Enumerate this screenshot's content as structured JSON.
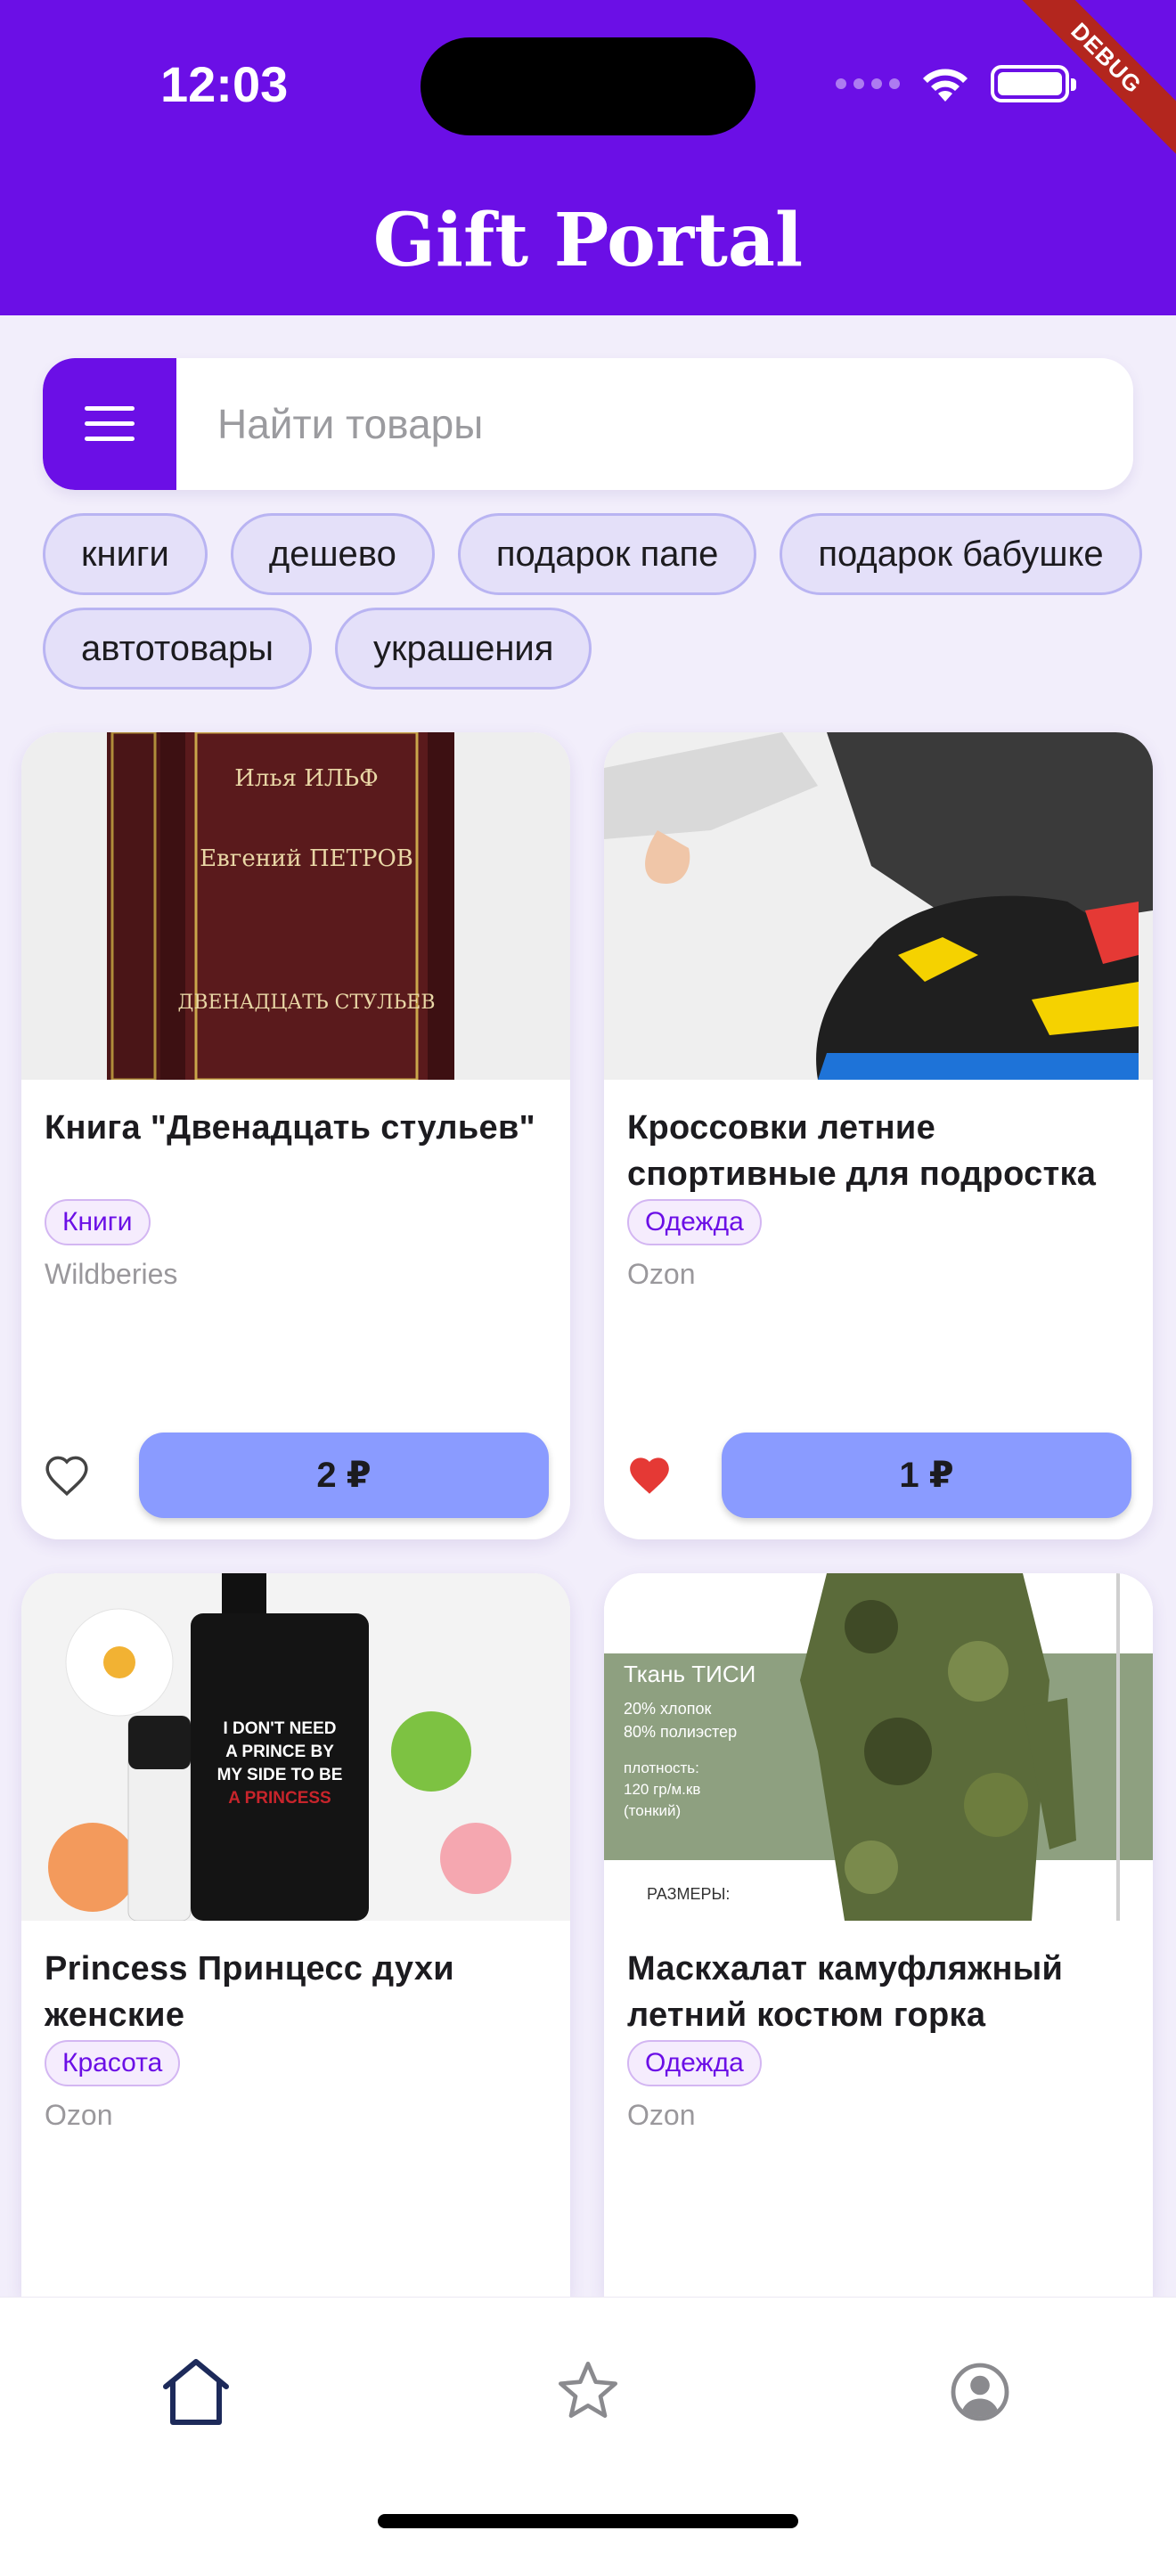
{
  "status_bar": {
    "time": "12:03",
    "debug_label": "DEBUG"
  },
  "app": {
    "title": "Gift Portal"
  },
  "search": {
    "placeholder": "Найти товары",
    "menu_icon": "menu-icon"
  },
  "chips": {
    "row1": [
      "книги",
      "дешево",
      "подарок папе",
      "подарок бабушке"
    ],
    "row2": [
      "автотовары",
      "украшения"
    ]
  },
  "products": [
    {
      "title": "Книга \"Двенадцать стульев\"",
      "category": "Книги",
      "store": "Wildberies",
      "price": "2 ₽",
      "favorite": false,
      "book_author1": "Илья ИЛЬФ",
      "book_author2": "Евгений ПЕТРОВ",
      "book_title": "ДВЕНАДЦАТЬ СТУЛЬЕВ"
    },
    {
      "title": "Кроссовки летние спортивные для подростка",
      "category": "Одежда",
      "store": "Ozon",
      "price": "1 ₽",
      "favorite": true
    },
    {
      "title": "Princess Принцесс духи женские",
      "category": "Красота",
      "store": "Ozon",
      "perfume_label": [
        "I DON'T NEED",
        "A PRINCE BY",
        "MY SIDE TO BE",
        "A PRINCESS"
      ]
    },
    {
      "title": "Маскхалат камуфляжный летний костюм горка",
      "category": "Одежда",
      "store": "Ozon",
      "fabric_label": [
        "Ткань ТИСИ",
        "20% хлопок",
        "80% полиэстер",
        "плотность:",
        "120 гр/м.кв",
        "(тонкий)",
        "РАЗМЕРЫ:"
      ]
    }
  ],
  "nav": [
    {
      "name": "home",
      "icon": "home-icon"
    },
    {
      "name": "favorites",
      "icon": "star-icon"
    },
    {
      "name": "profile",
      "icon": "account-icon"
    }
  ],
  "colors": {
    "primary": "#6b0fe6",
    "button": "#8a9bff",
    "background": "#f2eefb",
    "chip": "#e4e0f9",
    "heart": "#e53935"
  }
}
